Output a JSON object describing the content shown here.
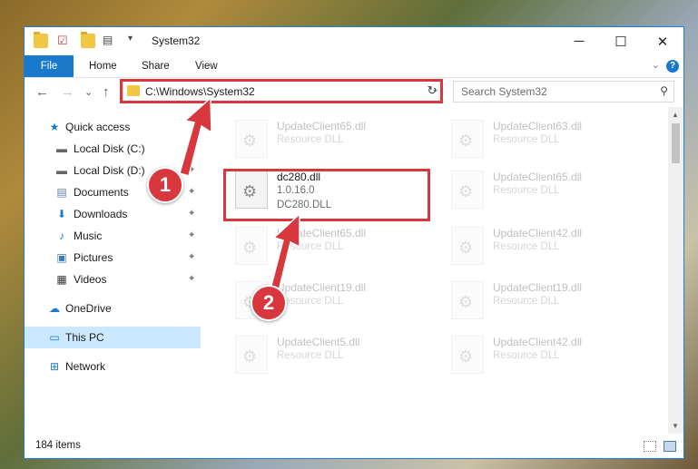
{
  "window": {
    "title": "System32",
    "minimize": "─",
    "maximize": "☐",
    "close": "✕"
  },
  "ribbon": {
    "tabs": [
      "File",
      "Home",
      "Share",
      "View"
    ],
    "help": "?",
    "expand": "⌄"
  },
  "navbar": {
    "back": "←",
    "forward": "→",
    "recent": "⌄",
    "up": "↑",
    "address": "C:\\Windows\\System32",
    "address_drop": "⌄",
    "refresh": "↻",
    "search_placeholder": "Search System32",
    "search_icon": "⚲"
  },
  "sidebar": {
    "items": [
      {
        "label": "Quick access",
        "icon": "★",
        "pinned": false
      },
      {
        "label": "Local Disk (C:)",
        "icon": "▬",
        "pinned": true
      },
      {
        "label": "Local Disk (D:)",
        "icon": "▬",
        "pinned": true
      },
      {
        "label": "Documents",
        "icon": "▤",
        "pinned": true
      },
      {
        "label": "Downloads",
        "icon": "⬇",
        "pinned": true
      },
      {
        "label": "Music",
        "icon": "♪",
        "pinned": true
      },
      {
        "label": "Pictures",
        "icon": "▣",
        "pinned": true
      },
      {
        "label": "Videos",
        "icon": "▦",
        "pinned": true
      },
      {
        "label": "OneDrive",
        "icon": "☁",
        "pinned": false
      },
      {
        "label": "This PC",
        "icon": "▭",
        "pinned": false
      },
      {
        "label": "Network",
        "icon": "⊞",
        "pinned": false
      }
    ],
    "pin_glyph": "📌"
  },
  "files": [
    {
      "name": "UpdateClient65.dll",
      "line2": "Resource DLL",
      "line3": "",
      "faded": true
    },
    {
      "name": "UpdateClient63.dll",
      "line2": "Resource DLL",
      "line3": "",
      "faded": true
    },
    {
      "name": "dc280.dll",
      "line2": "1.0.16.0",
      "line3": "DC280.DLL",
      "faded": false
    },
    {
      "name": "UpdateClient65.dll",
      "line2": "Resource DLL",
      "line3": "",
      "faded": true
    },
    {
      "name": "UpdateClient65.dll",
      "line2": "Resource DLL",
      "line3": "",
      "faded": true
    },
    {
      "name": "UpdateClient42.dll",
      "line2": "Resource DLL",
      "line3": "",
      "faded": true
    },
    {
      "name": "UpdateClient19.dll",
      "line2": "Resource DLL",
      "line3": "",
      "faded": true
    },
    {
      "name": "UpdateClient19.dll",
      "line2": "Resource DLL",
      "line3": "",
      "faded": true
    },
    {
      "name": "UpdateClient5.dll",
      "line2": "Resource DLL",
      "line3": "",
      "faded": true
    },
    {
      "name": "UpdateClient42.dll",
      "line2": "Resource DLL",
      "line3": "",
      "faded": true
    }
  ],
  "status": {
    "count": "184 items"
  },
  "callouts": [
    "1",
    "2"
  ],
  "colors": {
    "accent": "#1979ca",
    "highlight": "#d7373d",
    "selected": "#cce8ff"
  }
}
